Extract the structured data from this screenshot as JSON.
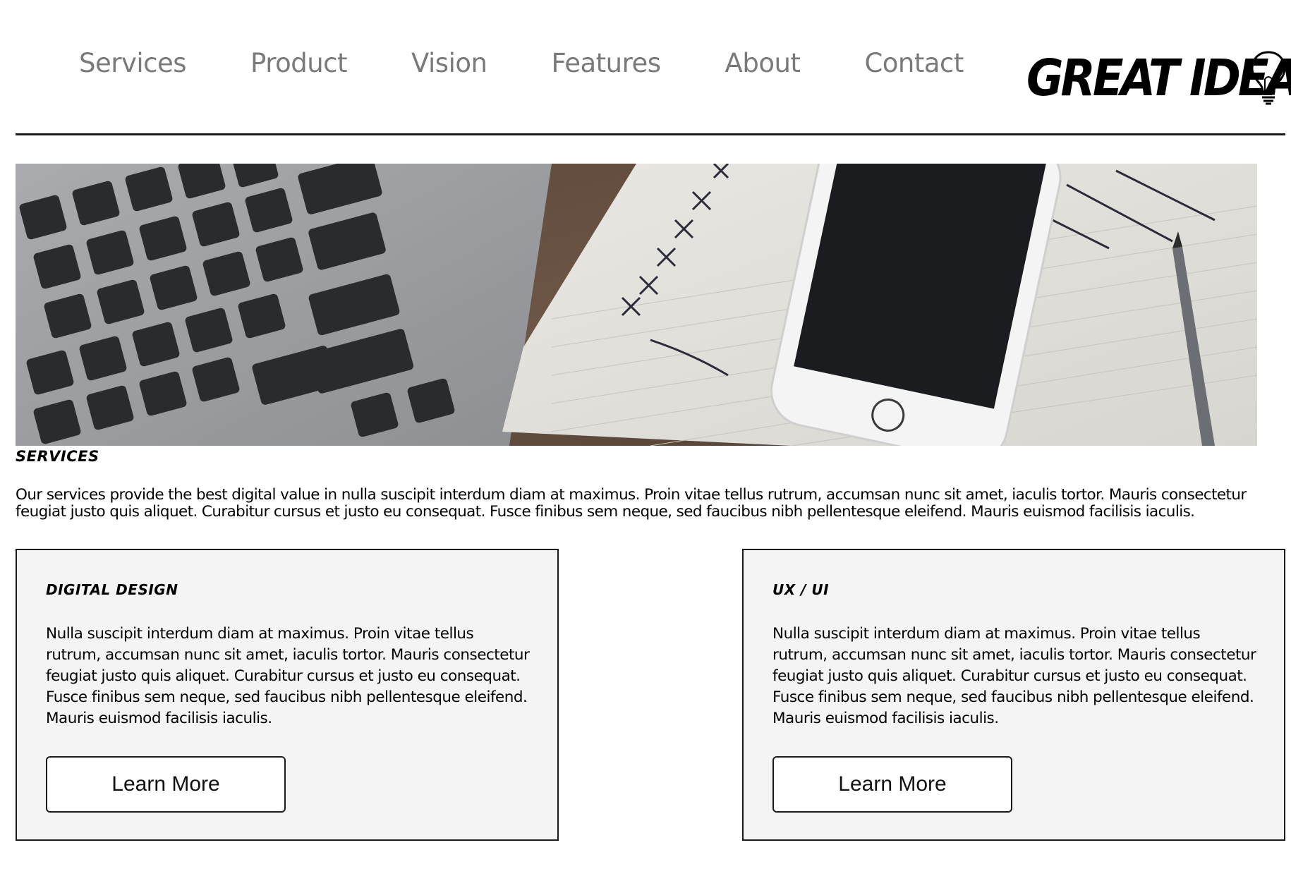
{
  "nav": {
    "items": [
      {
        "label": "Services"
      },
      {
        "label": "Product"
      },
      {
        "label": "Vision"
      },
      {
        "label": "Features"
      },
      {
        "label": "About"
      },
      {
        "label": "Contact"
      }
    ]
  },
  "logo": {
    "text": "GREAT IDEA",
    "icon": "lightbulb-icon"
  },
  "hero": {
    "description": "laptop keyboard, notebook and smartphone on desk"
  },
  "services": {
    "title": "Services",
    "text": "Our services provide the best digital value in nulla suscipit interdum diam at maximus. Proin vitae tellus rutrum, accumsan nunc sit amet, iaculis tortor. Mauris consectetur feugiat justo quis aliquet. Curabitur cursus et justo eu consequat. Fusce finibus sem neque, sed faucibus nibh pellentesque eleifend. Mauris euismod facilisis iaculis.",
    "cards": [
      {
        "title": "Digital Design",
        "text": "Nulla suscipit interdum diam at maximus. Proin vitae tellus rutrum, accumsan nunc sit amet, iaculis tortor. Mauris consectetur feugiat justo quis aliquet. Curabitur cursus et justo eu consequat. Fusce finibus sem neque, sed faucibus nibh pellentesque eleifend. Mauris euismod facilisis iaculis.",
        "button": "Learn More"
      },
      {
        "title": "UX / UI",
        "text": "Nulla suscipit interdum diam at maximus. Proin vitae tellus rutrum, accumsan nunc sit amet, iaculis tortor. Mauris consectetur feugiat justo quis aliquet. Curabitur cursus et justo eu consequat. Fusce finibus sem neque, sed faucibus nibh pellentesque eleifend. Mauris euismod facilisis iaculis.",
        "button": "Learn More"
      }
    ]
  }
}
